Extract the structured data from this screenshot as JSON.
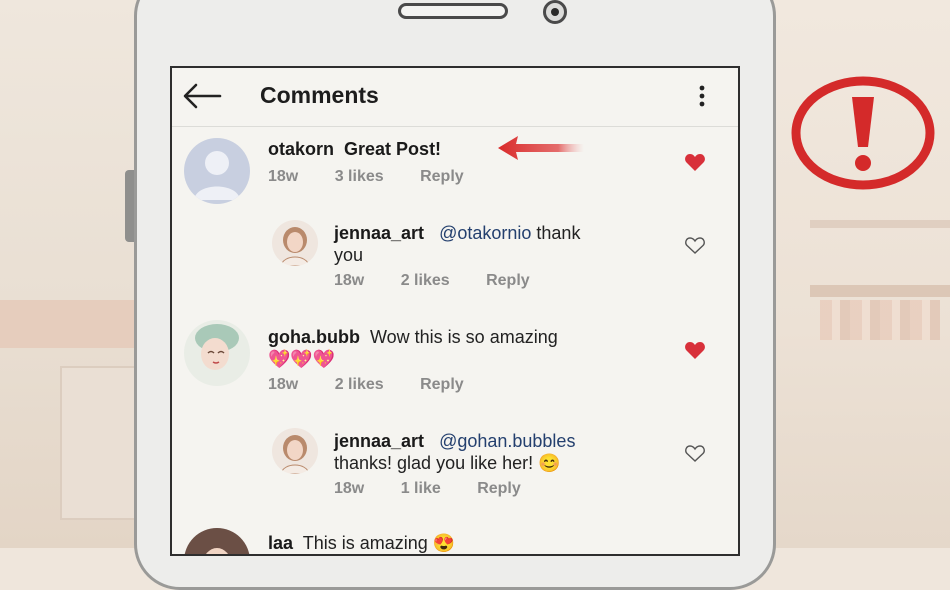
{
  "header": {
    "title": "Comments"
  },
  "comments": [
    {
      "user": "otakorn",
      "text": "Great Post!",
      "age": "18w",
      "likes": "3 likes",
      "reply": "Reply",
      "liked": true
    },
    {
      "user": "jennaa_art",
      "mention": "@otakornio",
      "text_line1": "thank",
      "text_line2": "you",
      "age": "18w",
      "likes": "2 likes",
      "reply": "Reply",
      "liked": false
    },
    {
      "user": "goha.bubb",
      "text": "Wow this is so amazing",
      "emoji": "💖💖💖",
      "age": "18w",
      "likes": "2 likes",
      "reply": "Reply",
      "liked": true
    },
    {
      "user": "jennaa_art",
      "mention": "@gohan.bubbles",
      "text_line2": "thanks! glad you like her! 😊",
      "age": "18w",
      "likes": "1 like",
      "reply": "Reply",
      "liked": false
    },
    {
      "user": "laa",
      "text": "This is amazing 😍"
    }
  ],
  "colors": {
    "liked_heart": "#d8303a",
    "alert_red": "#d42a2a",
    "arrow_red": "#d92a2a"
  },
  "icons": [
    "back-arrow-icon",
    "more-vertical-icon",
    "heart-filled-icon",
    "heart-outline-icon",
    "alert-icon"
  ]
}
